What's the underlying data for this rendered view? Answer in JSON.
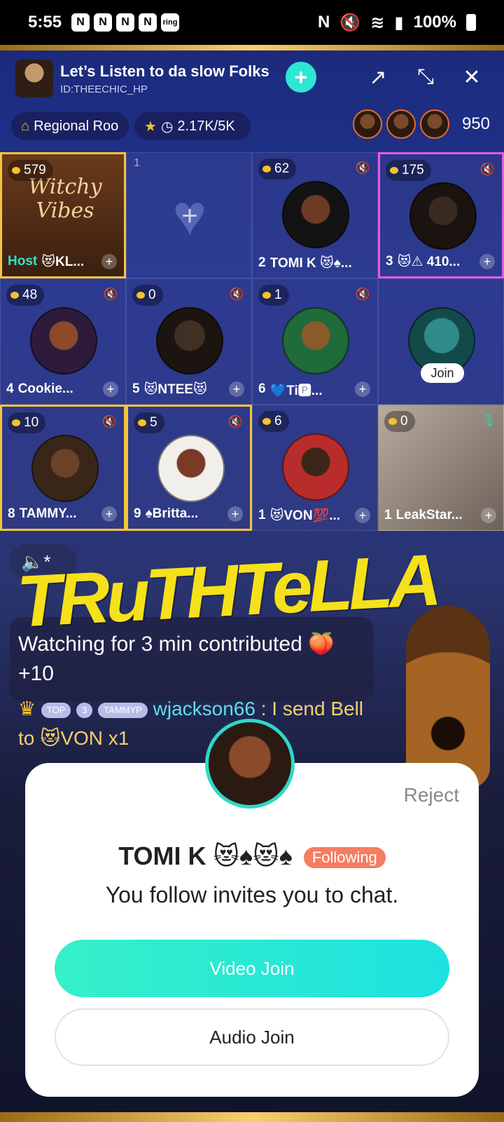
{
  "status_bar": {
    "time": "5:55",
    "battery": "100%",
    "notif_icons": [
      "N",
      "N",
      "N",
      "N",
      "ring"
    ]
  },
  "header": {
    "title": "Let’s Listen to da slow Folks",
    "room_id": "ID:THEECHIC_HP"
  },
  "chips": {
    "region": "Regional Roo",
    "stats": "2.17K/5K"
  },
  "viewer_count": "950",
  "seats": [
    {
      "coins": "579",
      "label_prefix": "Host",
      "name": "😻KL...",
      "overlay": "Witchy Vibes"
    },
    {
      "index": "1"
    },
    {
      "coins": "62",
      "num": "2",
      "name": "TOMI K 😻♠..."
    },
    {
      "coins": "175",
      "num": "3",
      "name": "😻⚠ 410..."
    },
    {
      "coins": "48",
      "num": "4",
      "name": "Cookie..."
    },
    {
      "coins": "0",
      "num": "5",
      "name": "😻NTEE😻"
    },
    {
      "coins": "1",
      "num": "6",
      "name": "💙Ti🅿..."
    },
    {
      "join": "Join"
    },
    {
      "coins": "10",
      "num": "8",
      "name": "TAMMY..."
    },
    {
      "coins": "5",
      "num": "9",
      "name": "♠Britta..."
    },
    {
      "coins": "6",
      "num": "1",
      "name": "😻VON💯..."
    },
    {
      "coins": "0",
      "num": "1",
      "name": "LeakStar..."
    }
  ],
  "overlay_text": "TRuTHTeLLA",
  "chat": {
    "line1": "Watching for 3 min contributed 🍑 +10",
    "badge_level": "3",
    "badge_text": "TAMMYP",
    "top_label": "TOP",
    "user": "wjackson66",
    "gift_text": ": I send Bell to 😻VON x1"
  },
  "invite": {
    "reject": "Reject",
    "inviter": "TOMI K 😻♠😻♠",
    "following": "Following",
    "message": "You follow invites you to chat.",
    "video_join": "Video Join",
    "audio_join": "Audio Join"
  }
}
